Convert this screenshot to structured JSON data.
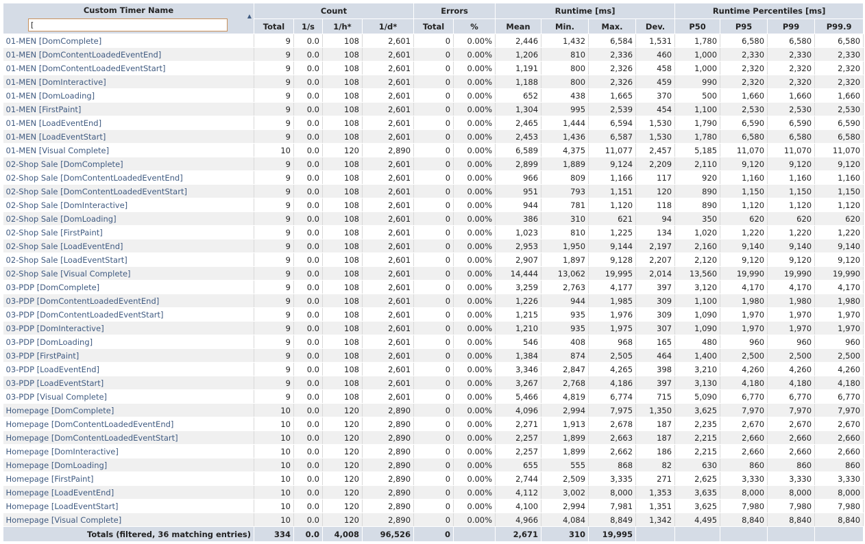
{
  "filter": {
    "value": "["
  },
  "headers": {
    "name": "Custom Timer Name",
    "groups": [
      "Count",
      "Errors",
      "Runtime [ms]",
      "Runtime Percentiles [ms]"
    ],
    "columns": [
      "Total",
      "1/s",
      "1/h*",
      "1/d*",
      "Total",
      "%",
      "Mean",
      "Min.",
      "Max.",
      "Dev.",
      "P50",
      "P95",
      "P99",
      "P99.9"
    ]
  },
  "rows": [
    [
      "01-MEN [DomComplete]",
      "9",
      "0.0",
      "108",
      "2,601",
      "0",
      "0.00%",
      "2,446",
      "1,432",
      "6,584",
      "1,531",
      "1,780",
      "6,580",
      "6,580",
      "6,580"
    ],
    [
      "01-MEN [DomContentLoadedEventEnd]",
      "9",
      "0.0",
      "108",
      "2,601",
      "0",
      "0.00%",
      "1,206",
      "810",
      "2,336",
      "460",
      "1,000",
      "2,330",
      "2,330",
      "2,330"
    ],
    [
      "01-MEN [DomContentLoadedEventStart]",
      "9",
      "0.0",
      "108",
      "2,601",
      "0",
      "0.00%",
      "1,191",
      "800",
      "2,326",
      "458",
      "1,000",
      "2,320",
      "2,320",
      "2,320"
    ],
    [
      "01-MEN [DomInteractive]",
      "9",
      "0.0",
      "108",
      "2,601",
      "0",
      "0.00%",
      "1,188",
      "800",
      "2,326",
      "459",
      "990",
      "2,320",
      "2,320",
      "2,320"
    ],
    [
      "01-MEN [DomLoading]",
      "9",
      "0.0",
      "108",
      "2,601",
      "0",
      "0.00%",
      "652",
      "438",
      "1,665",
      "370",
      "500",
      "1,660",
      "1,660",
      "1,660"
    ],
    [
      "01-MEN [FirstPaint]",
      "9",
      "0.0",
      "108",
      "2,601",
      "0",
      "0.00%",
      "1,304",
      "995",
      "2,539",
      "454",
      "1,100",
      "2,530",
      "2,530",
      "2,530"
    ],
    [
      "01-MEN [LoadEventEnd]",
      "9",
      "0.0",
      "108",
      "2,601",
      "0",
      "0.00%",
      "2,465",
      "1,444",
      "6,594",
      "1,530",
      "1,790",
      "6,590",
      "6,590",
      "6,590"
    ],
    [
      "01-MEN [LoadEventStart]",
      "9",
      "0.0",
      "108",
      "2,601",
      "0",
      "0.00%",
      "2,453",
      "1,436",
      "6,587",
      "1,530",
      "1,780",
      "6,580",
      "6,580",
      "6,580"
    ],
    [
      "01-MEN [Visual Complete]",
      "10",
      "0.0",
      "120",
      "2,890",
      "0",
      "0.00%",
      "6,589",
      "4,375",
      "11,077",
      "2,457",
      "5,185",
      "11,070",
      "11,070",
      "11,070"
    ],
    [
      "02-Shop Sale [DomComplete]",
      "9",
      "0.0",
      "108",
      "2,601",
      "0",
      "0.00%",
      "2,899",
      "1,889",
      "9,124",
      "2,209",
      "2,110",
      "9,120",
      "9,120",
      "9,120"
    ],
    [
      "02-Shop Sale [DomContentLoadedEventEnd]",
      "9",
      "0.0",
      "108",
      "2,601",
      "0",
      "0.00%",
      "966",
      "809",
      "1,166",
      "117",
      "920",
      "1,160",
      "1,160",
      "1,160"
    ],
    [
      "02-Shop Sale [DomContentLoadedEventStart]",
      "9",
      "0.0",
      "108",
      "2,601",
      "0",
      "0.00%",
      "951",
      "793",
      "1,151",
      "120",
      "890",
      "1,150",
      "1,150",
      "1,150"
    ],
    [
      "02-Shop Sale [DomInteractive]",
      "9",
      "0.0",
      "108",
      "2,601",
      "0",
      "0.00%",
      "944",
      "781",
      "1,120",
      "118",
      "890",
      "1,120",
      "1,120",
      "1,120"
    ],
    [
      "02-Shop Sale [DomLoading]",
      "9",
      "0.0",
      "108",
      "2,601",
      "0",
      "0.00%",
      "386",
      "310",
      "621",
      "94",
      "350",
      "620",
      "620",
      "620"
    ],
    [
      "02-Shop Sale [FirstPaint]",
      "9",
      "0.0",
      "108",
      "2,601",
      "0",
      "0.00%",
      "1,023",
      "810",
      "1,225",
      "134",
      "1,020",
      "1,220",
      "1,220",
      "1,220"
    ],
    [
      "02-Shop Sale [LoadEventEnd]",
      "9",
      "0.0",
      "108",
      "2,601",
      "0",
      "0.00%",
      "2,953",
      "1,950",
      "9,144",
      "2,197",
      "2,160",
      "9,140",
      "9,140",
      "9,140"
    ],
    [
      "02-Shop Sale [LoadEventStart]",
      "9",
      "0.0",
      "108",
      "2,601",
      "0",
      "0.00%",
      "2,907",
      "1,897",
      "9,128",
      "2,207",
      "2,120",
      "9,120",
      "9,120",
      "9,120"
    ],
    [
      "02-Shop Sale [Visual Complete]",
      "9",
      "0.0",
      "108",
      "2,601",
      "0",
      "0.00%",
      "14,444",
      "13,062",
      "19,995",
      "2,014",
      "13,560",
      "19,990",
      "19,990",
      "19,990"
    ],
    [
      "03-PDP [DomComplete]",
      "9",
      "0.0",
      "108",
      "2,601",
      "0",
      "0.00%",
      "3,259",
      "2,763",
      "4,177",
      "397",
      "3,120",
      "4,170",
      "4,170",
      "4,170"
    ],
    [
      "03-PDP [DomContentLoadedEventEnd]",
      "9",
      "0.0",
      "108",
      "2,601",
      "0",
      "0.00%",
      "1,226",
      "944",
      "1,985",
      "309",
      "1,100",
      "1,980",
      "1,980",
      "1,980"
    ],
    [
      "03-PDP [DomContentLoadedEventStart]",
      "9",
      "0.0",
      "108",
      "2,601",
      "0",
      "0.00%",
      "1,215",
      "935",
      "1,976",
      "309",
      "1,090",
      "1,970",
      "1,970",
      "1,970"
    ],
    [
      "03-PDP [DomInteractive]",
      "9",
      "0.0",
      "108",
      "2,601",
      "0",
      "0.00%",
      "1,210",
      "935",
      "1,975",
      "307",
      "1,090",
      "1,970",
      "1,970",
      "1,970"
    ],
    [
      "03-PDP [DomLoading]",
      "9",
      "0.0",
      "108",
      "2,601",
      "0",
      "0.00%",
      "546",
      "408",
      "968",
      "165",
      "480",
      "960",
      "960",
      "960"
    ],
    [
      "03-PDP [FirstPaint]",
      "9",
      "0.0",
      "108",
      "2,601",
      "0",
      "0.00%",
      "1,384",
      "874",
      "2,505",
      "464",
      "1,400",
      "2,500",
      "2,500",
      "2,500"
    ],
    [
      "03-PDP [LoadEventEnd]",
      "9",
      "0.0",
      "108",
      "2,601",
      "0",
      "0.00%",
      "3,346",
      "2,847",
      "4,265",
      "398",
      "3,210",
      "4,260",
      "4,260",
      "4,260"
    ],
    [
      "03-PDP [LoadEventStart]",
      "9",
      "0.0",
      "108",
      "2,601",
      "0",
      "0.00%",
      "3,267",
      "2,768",
      "4,186",
      "397",
      "3,130",
      "4,180",
      "4,180",
      "4,180"
    ],
    [
      "03-PDP [Visual Complete]",
      "9",
      "0.0",
      "108",
      "2,601",
      "0",
      "0.00%",
      "5,466",
      "4,819",
      "6,774",
      "715",
      "5,090",
      "6,770",
      "6,770",
      "6,770"
    ],
    [
      "Homepage [DomComplete]",
      "10",
      "0.0",
      "120",
      "2,890",
      "0",
      "0.00%",
      "4,096",
      "2,994",
      "7,975",
      "1,350",
      "3,625",
      "7,970",
      "7,970",
      "7,970"
    ],
    [
      "Homepage [DomContentLoadedEventEnd]",
      "10",
      "0.0",
      "120",
      "2,890",
      "0",
      "0.00%",
      "2,271",
      "1,913",
      "2,678",
      "187",
      "2,235",
      "2,670",
      "2,670",
      "2,670"
    ],
    [
      "Homepage [DomContentLoadedEventStart]",
      "10",
      "0.0",
      "120",
      "2,890",
      "0",
      "0.00%",
      "2,257",
      "1,899",
      "2,663",
      "187",
      "2,215",
      "2,660",
      "2,660",
      "2,660"
    ],
    [
      "Homepage [DomInteractive]",
      "10",
      "0.0",
      "120",
      "2,890",
      "0",
      "0.00%",
      "2,257",
      "1,899",
      "2,662",
      "186",
      "2,215",
      "2,660",
      "2,660",
      "2,660"
    ],
    [
      "Homepage [DomLoading]",
      "10",
      "0.0",
      "120",
      "2,890",
      "0",
      "0.00%",
      "655",
      "555",
      "868",
      "82",
      "630",
      "860",
      "860",
      "860"
    ],
    [
      "Homepage [FirstPaint]",
      "10",
      "0.0",
      "120",
      "2,890",
      "0",
      "0.00%",
      "2,744",
      "2,509",
      "3,335",
      "271",
      "2,625",
      "3,330",
      "3,330",
      "3,330"
    ],
    [
      "Homepage [LoadEventEnd]",
      "10",
      "0.0",
      "120",
      "2,890",
      "0",
      "0.00%",
      "4,112",
      "3,002",
      "8,000",
      "1,353",
      "3,635",
      "8,000",
      "8,000",
      "8,000"
    ],
    [
      "Homepage [LoadEventStart]",
      "10",
      "0.0",
      "120",
      "2,890",
      "0",
      "0.00%",
      "4,100",
      "2,994",
      "7,981",
      "1,351",
      "3,625",
      "7,980",
      "7,980",
      "7,980"
    ],
    [
      "Homepage [Visual Complete]",
      "10",
      "0.0",
      "120",
      "2,890",
      "0",
      "0.00%",
      "4,966",
      "4,084",
      "8,849",
      "1,342",
      "4,495",
      "8,840",
      "8,840",
      "8,840"
    ]
  ],
  "totals": [
    "Totals (filtered, 36 matching entries)",
    "334",
    "0.0",
    "4,008",
    "96,526",
    "0",
    "",
    "2,671",
    "310",
    "19,995",
    "",
    "",
    "",
    "",
    ""
  ]
}
